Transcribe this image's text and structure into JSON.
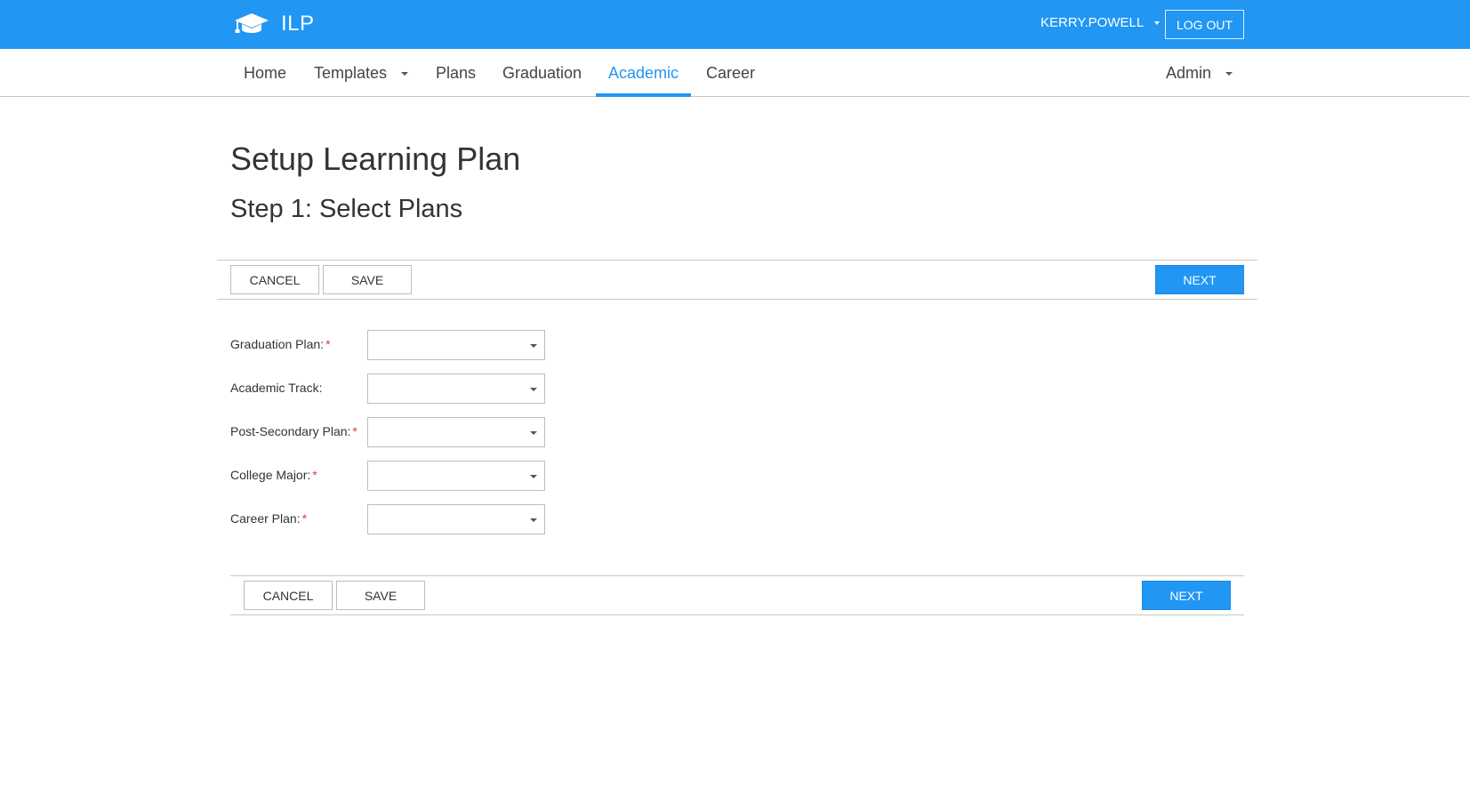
{
  "header": {
    "brand": "ILP",
    "username": "KERRY.POWELL",
    "logout_label": "LOG OUT",
    "accent_color": "#2196f3"
  },
  "nav": {
    "items": [
      {
        "label": "Home",
        "has_dropdown": false,
        "active": false
      },
      {
        "label": "Templates",
        "has_dropdown": true,
        "active": false
      },
      {
        "label": "Plans",
        "has_dropdown": false,
        "active": false
      },
      {
        "label": "Graduation",
        "has_dropdown": false,
        "active": false
      },
      {
        "label": "Academic",
        "has_dropdown": false,
        "active": true
      },
      {
        "label": "Career",
        "has_dropdown": false,
        "active": false
      }
    ],
    "admin_label": "Admin"
  },
  "page": {
    "title": "Setup Learning Plan",
    "step_title": "Step 1: Select Plans"
  },
  "actions": {
    "cancel_label": "CANCEL",
    "save_label": "SAVE",
    "next_label": "NEXT"
  },
  "form": {
    "required_marker": "*",
    "fields": [
      {
        "label": "Graduation Plan:",
        "required": true,
        "value": ""
      },
      {
        "label": "Academic Track:",
        "required": false,
        "value": ""
      },
      {
        "label": "Post-Secondary Plan:",
        "required": true,
        "value": ""
      },
      {
        "label": "College Major:",
        "required": true,
        "value": ""
      },
      {
        "label": "Career Plan:",
        "required": true,
        "value": ""
      }
    ]
  },
  "icons": {
    "brand": "graduation-cap-icon",
    "dropdown": "chevron-down-icon"
  }
}
